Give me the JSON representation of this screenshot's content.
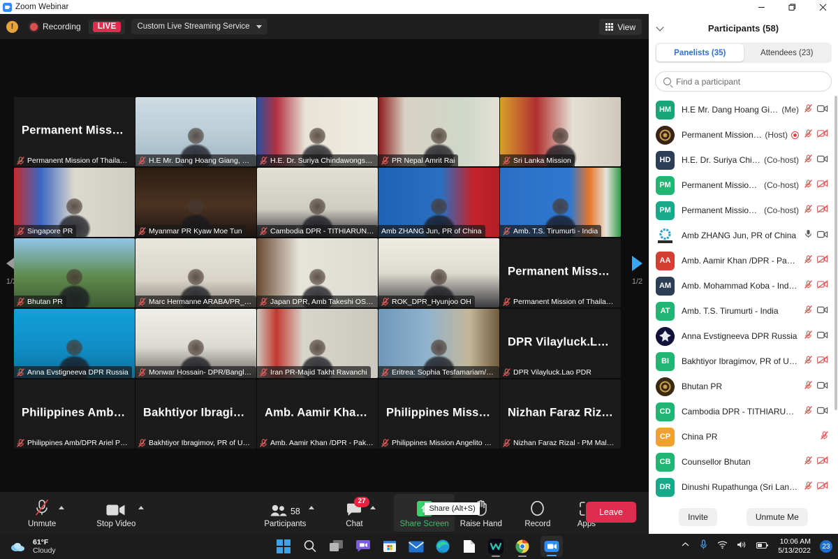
{
  "window": {
    "title": "Zoom Webinar",
    "minimize_label": "minimize",
    "restore_label": "restore",
    "close_label": "close"
  },
  "meeting_top": {
    "recording_label": "Recording",
    "live_label": "LIVE",
    "stream_service": "Custom Live Streaming Service",
    "view_label": "View"
  },
  "stage": {
    "page_indicator": "1/2",
    "tiles": [
      {
        "name": "Permanent Mission of Thailan…",
        "big": "Permanent  Miss…",
        "muted": true,
        "style": "dark",
        "active": false
      },
      {
        "name": "H.E Mr. Dang Hoang Giang, P…",
        "big": "",
        "muted": true,
        "style": "vid-giang",
        "active": false
      },
      {
        "name": "H.E. Dr. Suriya Chindawongse,…",
        "big": "",
        "muted": true,
        "style": "vid-suriya",
        "active": false
      },
      {
        "name": "PR Nepal Amrit Rai",
        "big": "",
        "muted": true,
        "style": "vid-nepal",
        "active": false
      },
      {
        "name": "Sri Lanka Mission",
        "big": "",
        "muted": true,
        "style": "vid-srilanka",
        "active": false
      },
      {
        "name": "Singapore PR",
        "big": "",
        "muted": true,
        "style": "vid-singapore",
        "active": false
      },
      {
        "name": "Myanmar PR Kyaw Moe Tun",
        "big": "",
        "muted": true,
        "style": "vid-myanmar",
        "active": false
      },
      {
        "name": "Cambodia DPR - TITHIARUN …",
        "big": "",
        "muted": true,
        "style": "vid-cambodia",
        "active": false
      },
      {
        "name": "Amb ZHANG Jun, PR of China",
        "big": "",
        "muted": false,
        "style": "vid-china",
        "active": true
      },
      {
        "name": "Amb. T.S. Tirumurti - India",
        "big": "",
        "muted": true,
        "style": "vid-india",
        "active": false
      },
      {
        "name": "Bhutan PR",
        "big": "",
        "muted": true,
        "style": "vid-bhutan",
        "active": false
      },
      {
        "name": "Marc Hermanne ARABA/PR_B…",
        "big": "",
        "muted": true,
        "style": "vid-araba",
        "active": false
      },
      {
        "name": "Japan DPR, Amb Takeshi OSU…",
        "big": "",
        "muted": true,
        "style": "vid-japan",
        "active": false
      },
      {
        "name": "ROK_DPR_Hyunjoo OH",
        "big": "",
        "muted": true,
        "style": "vid-rok",
        "active": false
      },
      {
        "name": "Permanent Mission of Thailan…",
        "big": "Permanent  Miss…",
        "muted": true,
        "style": "dark",
        "active": false
      },
      {
        "name": "Anna Evstigneeva DPR Russia",
        "big": "",
        "muted": true,
        "style": "vid-russia",
        "active": false
      },
      {
        "name": "Monwar Hossain- DPR/Bangla…",
        "big": "",
        "muted": true,
        "style": "vid-bangla",
        "active": false
      },
      {
        "name": "Iran PR-Majid Takht Ravanchi",
        "big": "",
        "muted": true,
        "style": "vid-iran",
        "active": false
      },
      {
        "name": "Eritrea: Sophia Tesfamariam/PR",
        "big": "",
        "muted": true,
        "style": "vid-eritrea",
        "active": false
      },
      {
        "name": "DPR Vilayluck.Lao PDR",
        "big": "DPR  Vilayluck.L…",
        "muted": true,
        "style": "dark",
        "active": false
      },
      {
        "name": "Philippines Amb/DPR Ariel Pe…",
        "big": "Philippines  Amb…",
        "muted": true,
        "style": "dark",
        "active": false
      },
      {
        "name": "Bakhtiyor Ibragimov, PR of Uz…",
        "big": "Bakhtiyor  Ibragi…",
        "muted": true,
        "style": "dark",
        "active": false
      },
      {
        "name": "Amb. Aamir Khan /DPR - Paki…",
        "big": "Amb. Aamir  Kha…",
        "muted": true,
        "style": "dark",
        "active": false
      },
      {
        "name": "Philippines Mission Angelito …",
        "big": "Philippines  Miss…",
        "muted": true,
        "style": "dark",
        "active": false
      },
      {
        "name": "Nizhan Faraz Rizal - PM Mala…",
        "big": "Nizhan  Faraz  Riz…",
        "muted": true,
        "style": "dark",
        "active": false
      }
    ]
  },
  "controls": {
    "items": [
      {
        "name": "unmute",
        "label": "Unmute",
        "icon": "mic-off-icon",
        "has_chevron": true,
        "badge": "",
        "count": ""
      },
      {
        "name": "stop-video",
        "label": "Stop Video",
        "icon": "camera-icon",
        "has_chevron": true,
        "badge": "",
        "count": ""
      },
      {
        "name": "participants",
        "label": "Participants",
        "icon": "people-icon",
        "has_chevron": true,
        "badge": "",
        "count": "58"
      },
      {
        "name": "chat",
        "label": "Chat",
        "icon": "chat-icon",
        "has_chevron": true,
        "badge": "27",
        "count": ""
      },
      {
        "name": "share-screen",
        "label": "Share Screen",
        "icon": "share-up-arrow-icon",
        "has_chevron": false,
        "badge": "",
        "count": ""
      },
      {
        "name": "raise-hand",
        "label": "Raise Hand",
        "icon": "hand-icon",
        "has_chevron": false,
        "badge": "",
        "count": ""
      },
      {
        "name": "record",
        "label": "Record",
        "icon": "record-circle-icon",
        "has_chevron": false,
        "badge": "",
        "count": ""
      },
      {
        "name": "apps",
        "label": "Apps",
        "icon": "apps-icon",
        "has_chevron": false,
        "badge": "",
        "count": ""
      }
    ],
    "share_tooltip": "Share (Alt+S)",
    "leave_label": "Leave"
  },
  "panel": {
    "title": "Participants (58)",
    "tabs": [
      {
        "label": "Panelists (35)",
        "active": true
      },
      {
        "label": "Attendees (23)",
        "active": false
      }
    ],
    "search_placeholder": "Find a participant",
    "invite_label": "Invite",
    "unmute_me_label": "Unmute Me",
    "participants": [
      {
        "initials": "HM",
        "color": "#18a678",
        "round": false,
        "name": "H.E Mr. Dang Hoang Gian…",
        "role": "(Me)",
        "mic": "muted",
        "video": "on"
      },
      {
        "initials": "",
        "color": "#3a2418",
        "round": true,
        "name": "Permanent Mission …",
        "role": "(Host)",
        "mic": "muted",
        "video": "off",
        "host_dot": true
      },
      {
        "initials": "HD",
        "color": "#2c3e55",
        "round": false,
        "name": "H.E. Dr. Suriya Chinda…",
        "role": "(Co-host)",
        "mic": "muted",
        "video": "on"
      },
      {
        "initials": "PM",
        "color": "#22b573",
        "round": false,
        "name": "Permanent Mission o…",
        "role": "(Co-host)",
        "mic": "muted",
        "video": "off"
      },
      {
        "initials": "PM",
        "color": "#17a98a",
        "round": false,
        "name": "Permanent Mission o…",
        "role": "(Co-host)",
        "mic": "muted",
        "video": "off"
      },
      {
        "initials": "",
        "color": "#ffffff",
        "round": false,
        "name": "Amb ZHANG Jun, PR of China",
        "role": "",
        "mic": "on",
        "video": "on"
      },
      {
        "initials": "AA",
        "color": "#d43f34",
        "round": false,
        "name": "Amb. Aamir Khan /DPR - Pakist…",
        "role": "",
        "mic": "muted",
        "video": "off"
      },
      {
        "initials": "AM",
        "color": "#2c3e55",
        "round": false,
        "name": "Amb. Mohammad Koba - Indon…",
        "role": "",
        "mic": "muted",
        "video": "off"
      },
      {
        "initials": "AT",
        "color": "#21b573",
        "round": false,
        "name": "Amb. T.S. Tirumurti - India",
        "role": "",
        "mic": "muted",
        "video": "on"
      },
      {
        "initials": "",
        "color": "#10123a",
        "round": true,
        "name": "Anna Evstigneeva DPR Russia",
        "role": "",
        "mic": "muted",
        "video": "on"
      },
      {
        "initials": "BI",
        "color": "#21b573",
        "round": false,
        "name": "Bakhtiyor Ibragimov, PR of Uzb…",
        "role": "",
        "mic": "muted",
        "video": "off"
      },
      {
        "initials": "",
        "color": "#3a2a12",
        "round": true,
        "name": "Bhutan PR",
        "role": "",
        "mic": "muted",
        "video": "on"
      },
      {
        "initials": "CD",
        "color": "#21b573",
        "round": false,
        "name": "Cambodia DPR - TITHIARUN M…",
        "role": "",
        "mic": "muted",
        "video": "on"
      },
      {
        "initials": "CP",
        "color": "#f0a132",
        "round": false,
        "name": "China PR",
        "role": "",
        "mic": "muted",
        "video": ""
      },
      {
        "initials": "CB",
        "color": "#21b573",
        "round": false,
        "name": "Counsellor Bhutan",
        "role": "",
        "mic": "muted",
        "video": "off"
      },
      {
        "initials": "DR",
        "color": "#17a98a",
        "round": false,
        "name": "Dinushi Rupathunga (Sri Lanka)",
        "role": "",
        "mic": "muted",
        "video": "off"
      }
    ]
  },
  "taskbar": {
    "weather_temp": "61°F",
    "weather_cond": "Cloudy",
    "apps": [
      {
        "name": "start-button"
      },
      {
        "name": "search-icon"
      },
      {
        "name": "task-view-icon"
      },
      {
        "name": "chat-teams-icon"
      },
      {
        "name": "microsoft-store-icon"
      },
      {
        "name": "mail-icon"
      },
      {
        "name": "edge-icon"
      },
      {
        "name": "file-explorer-icon"
      },
      {
        "name": "webex-icon"
      },
      {
        "name": "chrome-icon"
      },
      {
        "name": "zoom-icon"
      }
    ],
    "time": "10:06 AM",
    "date": "5/13/2022",
    "notification_count": "23"
  }
}
